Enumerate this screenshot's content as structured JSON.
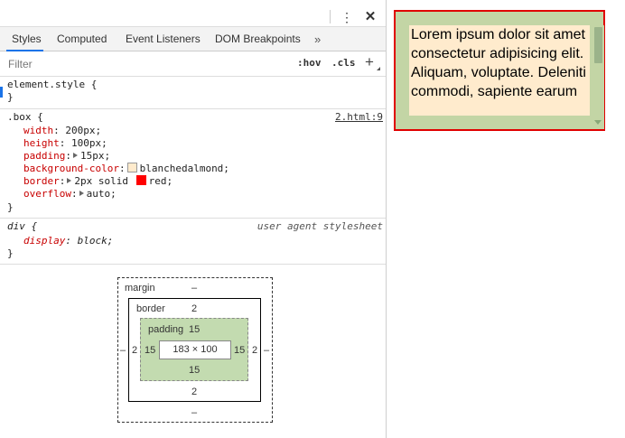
{
  "toolbar": {
    "more_icon": "⋮",
    "close_icon": "✕"
  },
  "tabs": [
    {
      "label": "Styles",
      "active": true
    },
    {
      "label": "Computed",
      "active": false
    },
    {
      "label": "Event Listeners",
      "active": false
    },
    {
      "label": "DOM Breakpoints",
      "active": false
    }
  ],
  "tab_more": "»",
  "filter": {
    "placeholder": "Filter",
    "hov": ":hov",
    "cls": ".cls",
    "add": "+"
  },
  "rules": {
    "element_style": {
      "selector": "element.style {",
      "close": "}"
    },
    "box": {
      "selector": ".box {",
      "source": "2.html:9",
      "props": [
        {
          "name": "width",
          "value": "200px;"
        },
        {
          "name": "height",
          "value": "100px;"
        },
        {
          "name": "padding",
          "value": "15px;"
        },
        {
          "name": "background-color",
          "value": "blanchedalmond;",
          "swatch": "#ffebcd"
        },
        {
          "name": "border",
          "value": "2px solid ",
          "value2": "red;",
          "swatch": "#ff0000"
        },
        {
          "name": "overflow",
          "value": "auto;"
        }
      ],
      "close": "}"
    },
    "div": {
      "selector": "div {",
      "source": "user agent stylesheet",
      "props": [
        {
          "name": "display",
          "value": "block;"
        }
      ],
      "close": "}"
    }
  },
  "box_model": {
    "margin_label": "margin",
    "margin_top": "–",
    "margin_bottom": "–",
    "margin_left": "–",
    "margin_right": "–",
    "border_label": "border",
    "border_top": "2",
    "border_bottom": "2",
    "border_left": "2",
    "border_right": "2",
    "padding_label": "padding",
    "padding_top": "15",
    "padding_bottom": "15",
    "padding_left": "15",
    "padding_right": "15",
    "content": "183 × 100"
  },
  "preview": {
    "text": "Lorem ipsum dolor sit amet consectetur adipisicing elit. Aliquam, voluptate. Deleniti commodi, sapiente earum",
    "border_color": "#e00000",
    "background": "#ffebcd"
  }
}
